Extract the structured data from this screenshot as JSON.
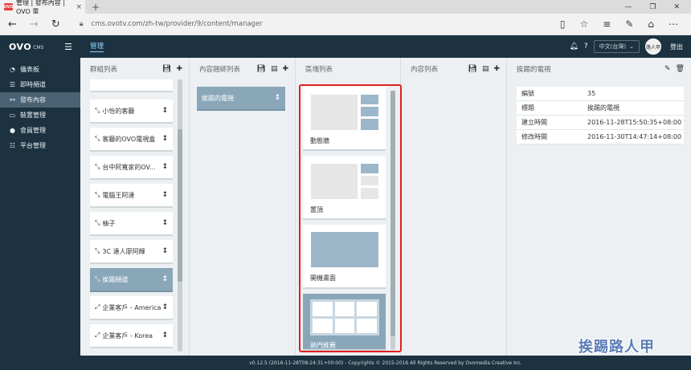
{
  "browser": {
    "tab_title": "管理 | 發布內容 | OVO 電",
    "favicon_text": "OVO",
    "tab_close": "×",
    "new_tab": "+",
    "url": "cms.ovotv.com/zh-tw/provider/9/content/manager",
    "back": "←",
    "forward": "→",
    "refresh": "↻",
    "window_min": "—",
    "window_max": "❐",
    "window_close": "✕"
  },
  "header": {
    "logo": "OVO",
    "logo_sub": "CMS",
    "breadcrumb": "管理",
    "language": "中文(台灣)",
    "logout": "登出",
    "avatar_text": "路人甲"
  },
  "sidebar": {
    "items": [
      {
        "label": "儀表板",
        "icon": "dashboard-icon",
        "glyph": "◔"
      },
      {
        "label": "即時頻道",
        "icon": "list-icon",
        "glyph": "☰"
      },
      {
        "label": "發布內容",
        "icon": "share-icon",
        "glyph": "⚯",
        "active": true
      },
      {
        "label": "裝置管理",
        "icon": "monitor-icon",
        "glyph": "▭"
      },
      {
        "label": "會員管理",
        "icon": "user-icon",
        "glyph": "●"
      },
      {
        "label": "平台管理",
        "icon": "grid-icon",
        "glyph": "☷"
      }
    ]
  },
  "columns": {
    "groups": {
      "title": "群組列表",
      "items": [
        "小怡的客廳",
        "客廳的OVO電視盒",
        "台中阿寬家的OV...",
        "電腦王阿達",
        "柚子",
        "3C 達人廖阿輝",
        "挨踢頻道",
        "企業客戶 - America",
        "企業客戶 - Korea"
      ],
      "selected_index": 6
    },
    "bundles": {
      "title": "內容捆綁列表",
      "items": [
        "挨踢的電視"
      ]
    },
    "blocks": {
      "title": "區塊列表",
      "items": [
        "動態牆",
        "置頂",
        "開機畫面",
        "熱門推薦"
      ]
    },
    "contents": {
      "title": "內容列表"
    },
    "detail": {
      "title": "挨踢的電視",
      "rows": [
        {
          "key": "編號",
          "value": "35"
        },
        {
          "key": "標題",
          "value": "挨踢的電視"
        },
        {
          "key": "建立時間",
          "value": "2016-11-28T15:50:35+08:00"
        },
        {
          "key": "修改時間",
          "value": "2016-11-30T14:47:14+08:00"
        }
      ]
    }
  },
  "footer": "v0.12.5 (2016-11-28T08:24:31+00:00) - Copyrights © 2015-2016 All Rights Reserved by Ovomedia Creative Inc.",
  "watermark": "挨踢路人甲"
}
